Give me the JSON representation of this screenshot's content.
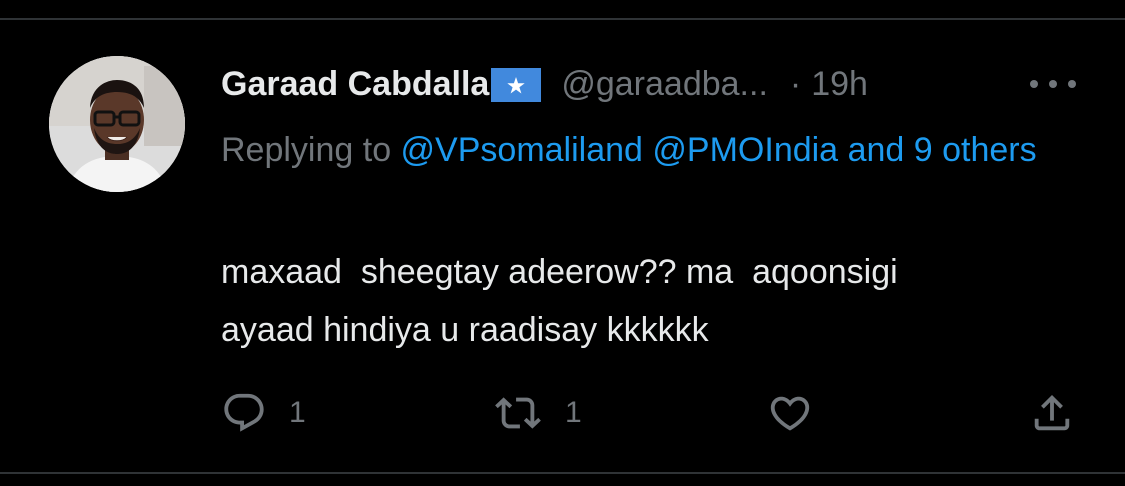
{
  "tweet": {
    "author": {
      "display_name": "Garaad Cabdalla",
      "flag": "somalia-flag",
      "handle": "@garaadba...",
      "avatar": "profile-photo"
    },
    "separator": "·",
    "timestamp": "19h",
    "replying": {
      "prefix": "Replying to ",
      "mention_1": "@VPsomaliland",
      "mention_2": "@PMOIndia",
      "others": "and 9 others"
    },
    "text": "maxaad  sheegtay adeerow?? ma  aqoonsigi\nayaad hindiya u raadisay kkkkkk",
    "actions": {
      "reply_icon": "reply-icon",
      "reply_count": "1",
      "retweet_icon": "retweet-icon",
      "retweet_count": "1",
      "like_icon": "heart-icon",
      "share_icon": "share-icon"
    },
    "more_icon": "more-horizontal-icon"
  },
  "colors": {
    "background": "#000000",
    "text_primary": "#e7e9ea",
    "text_secondary": "#71767b",
    "link": "#1d9bf0",
    "divider": "#2f3336",
    "flag_blue": "#4189dd"
  }
}
